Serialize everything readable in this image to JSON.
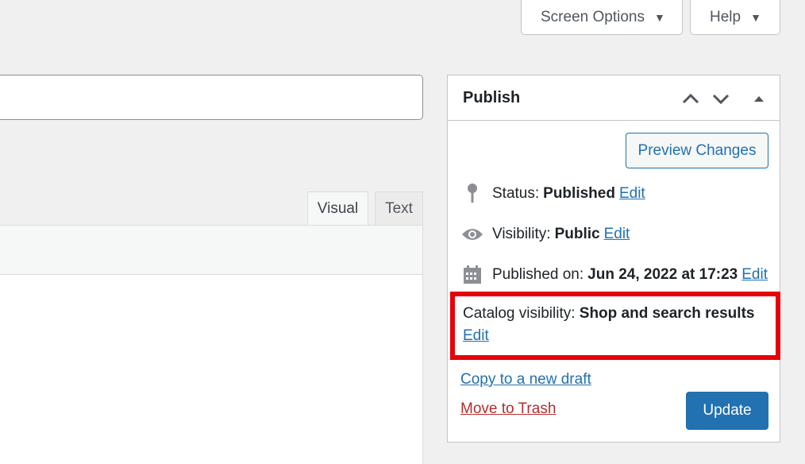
{
  "screen_meta": {
    "screen_options_label": "Screen Options",
    "help_label": "Help"
  },
  "editor": {
    "tabs": [
      {
        "label": "Visual",
        "active": true
      },
      {
        "label": "Text",
        "active": false
      }
    ]
  },
  "publish": {
    "title": "Publish",
    "preview_label": "Preview Changes",
    "status": {
      "label": "Status:",
      "value": "Published",
      "edit": "Edit"
    },
    "visibility": {
      "label": "Visibility:",
      "value": "Public",
      "edit": "Edit"
    },
    "published_on": {
      "label": "Published on:",
      "value": "Jun 24, 2022 at 17:23",
      "edit": "Edit"
    },
    "catalog_visibility": {
      "label": "Catalog visibility:",
      "value": "Shop and search results",
      "edit": "Edit"
    },
    "copy_draft_label": "Copy to a new draft",
    "trash_label": "Move to Trash",
    "update_label": "Update"
  },
  "colors": {
    "accent": "#2271b1",
    "highlight": "#e8000b",
    "trash": "#b32d2e"
  }
}
